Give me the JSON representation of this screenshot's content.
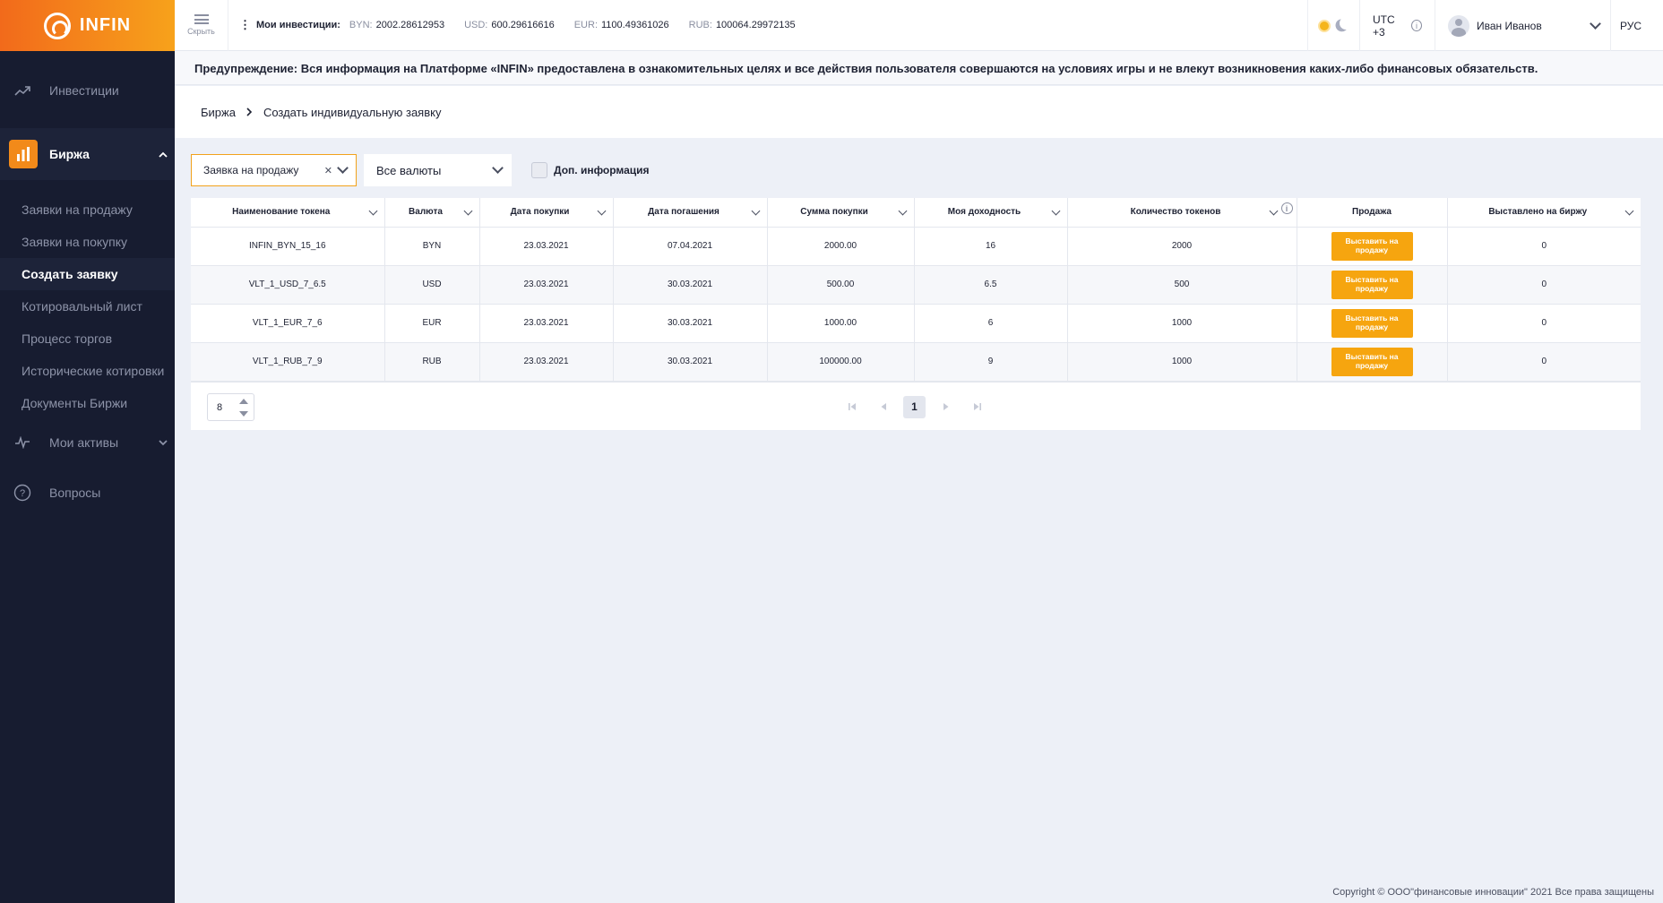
{
  "app": {
    "name": "INFIN"
  },
  "sidebar": {
    "investments": "Инвестиции",
    "birzha": "Биржа",
    "sub": [
      "Заявки на продажу",
      "Заявки на покупку",
      "Создать заявку",
      "Котировальный лист",
      "Процесс торгов",
      "Исторические котировки",
      "Документы Биржи"
    ],
    "assets": "Мои активы",
    "faq": "Вопросы"
  },
  "topbar": {
    "hide_label": "Скрыть",
    "title": "Мои инвестиции:",
    "balances": [
      {
        "cur": "BYN:",
        "val": "2002.28612953"
      },
      {
        "cur": "USD:",
        "val": "600.29616616"
      },
      {
        "cur": "EUR:",
        "val": "1100.49361026"
      },
      {
        "cur": "RUB:",
        "val": "100064.29972135"
      }
    ],
    "timezone": "UTC +3",
    "user": "Иван Иванов",
    "lang": "РУС"
  },
  "warning": "Предупреждение: Вся информация на Платформе «INFIN» предоставлена в ознакомительных целях и все действия пользователя совершаются на условиях игры и не влекут возникновения каких-либо финансовых обязательств.",
  "breadcrumb": {
    "root": "Биржа",
    "current": "Создать индивидуальную заявку"
  },
  "filters": {
    "type": "Заявка на продажу",
    "currency": "Все валюты",
    "extra_info": "Доп. информация"
  },
  "table": {
    "headers": [
      "Наименование токена",
      "Валюта",
      "Дата покупки",
      "Дата погашения",
      "Сумма покупки",
      "Моя доходность",
      "Количество токенов",
      "Продажа",
      "Выставлено на биржу"
    ],
    "sell_label": "Выставить на продажу",
    "rows": [
      {
        "token": "INFIN_BYN_15_16",
        "currency": "BYN",
        "buy_date": "23.03.2021",
        "due_date": "07.04.2021",
        "sum": "2000.00",
        "yield": "16",
        "qty": "2000",
        "listed": "0"
      },
      {
        "token": "VLT_1_USD_7_6.5",
        "currency": "USD",
        "buy_date": "23.03.2021",
        "due_date": "30.03.2021",
        "sum": "500.00",
        "yield": "6.5",
        "qty": "500",
        "listed": "0"
      },
      {
        "token": "VLT_1_EUR_7_6",
        "currency": "EUR",
        "buy_date": "23.03.2021",
        "due_date": "30.03.2021",
        "sum": "1000.00",
        "yield": "6",
        "qty": "1000",
        "listed": "0"
      },
      {
        "token": "VLT_1_RUB_7_9",
        "currency": "RUB",
        "buy_date": "23.03.2021",
        "due_date": "30.03.2021",
        "sum": "100000.00",
        "yield": "9",
        "qty": "1000",
        "listed": "0"
      }
    ]
  },
  "pagination": {
    "page_size": "8",
    "current_page": "1"
  },
  "footer": "Copyright © ООО\"финансовые инновации\" 2021 Все права защищены",
  "colors": {
    "accent": "#f6a50f",
    "sidebar": "#171c30"
  }
}
